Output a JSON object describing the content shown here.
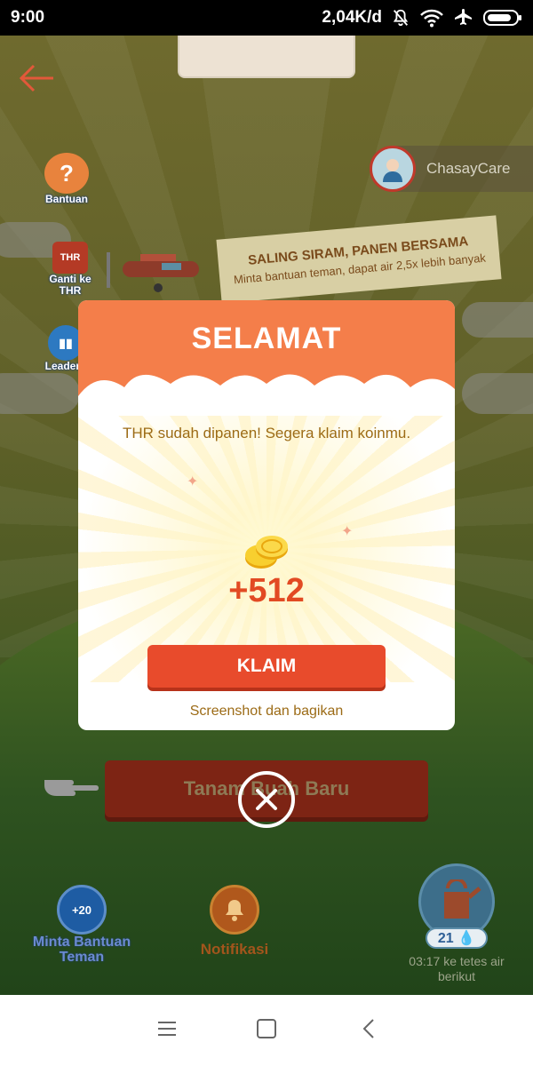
{
  "status_bar": {
    "time": "9:00",
    "network_speed": "2,04K/d",
    "icons": [
      "notifications-off-icon",
      "wifi-icon",
      "airplane-mode-icon",
      "battery-icon"
    ]
  },
  "game": {
    "left_menu": {
      "help_label": "Bantuan",
      "thr_badge": "THR",
      "thr_label": "Ganti ke THR",
      "leaderboard_label": "Leaderb"
    },
    "profile": {
      "name": "ChasayCare"
    },
    "banner": {
      "title": "SALING SIRAM, PANEN BERSAMA",
      "subtitle": "Minta bantuan teman, dapat air 2,5x lebih banyak"
    },
    "plant_button_label": "Tanam Buah Baru",
    "bottom": {
      "ask_help_badge": "+20",
      "ask_help_label": "Minta Bantuan Teman",
      "notification_label": "Notifikasi",
      "water_count": "21",
      "water_timer": "03:17 ke tetes air berikut"
    }
  },
  "modal": {
    "title": "SELAMAT",
    "message": "THR sudah dipanen! Segera klaim koinmu.",
    "amount": "+512",
    "claim_label": "KLAIM",
    "share_label": "Screenshot dan bagikan"
  },
  "colors": {
    "modal_header": "#f47e4a",
    "claim_button": "#e84b2c",
    "amount": "#e24a23",
    "message_text": "#9c6b16"
  }
}
